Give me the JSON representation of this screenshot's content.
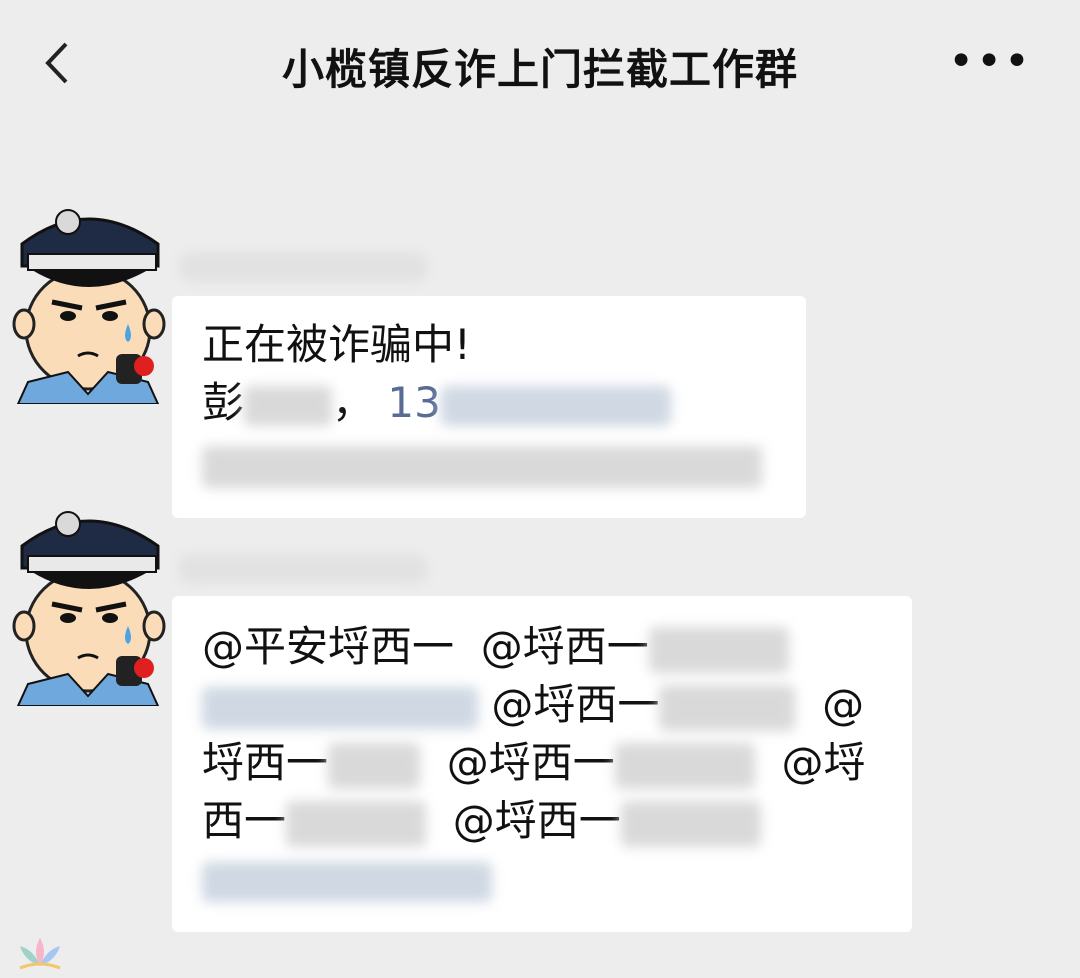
{
  "header": {
    "title": "小榄镇反诈上门拦截工作群",
    "back_icon": "chevron-left-icon",
    "more_icon": "more-dots-icon",
    "more_glyph": "•••"
  },
  "messages": [
    {
      "avatar": "police-cartoon-avatar",
      "lines": [
        "正在被诈骗中!",
        "彭",
        "，",
        "13"
      ]
    },
    {
      "avatar": "police-cartoon-avatar",
      "mentions": [
        "@平安埒西一",
        "@埒西一",
        "@埒西一",
        "@",
        "埒西一",
        "@埒西一",
        "@埒",
        "西一",
        "@埒西一"
      ]
    }
  ],
  "colors": {
    "background": "#ededed",
    "bubble": "#ffffff",
    "phone_link": "#576b95"
  }
}
